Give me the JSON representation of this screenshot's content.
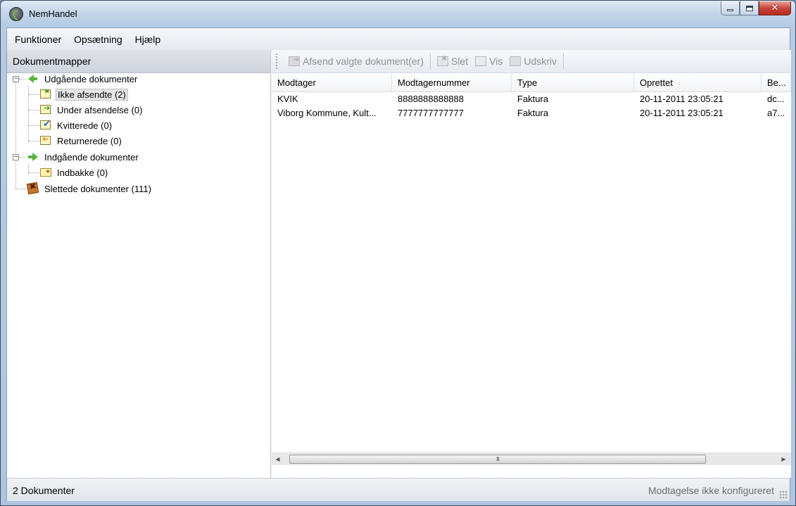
{
  "window": {
    "title": "NemHandel",
    "icon": "nemhandel-logo-icon",
    "caption_buttons": [
      "minimize",
      "maximize",
      "close"
    ]
  },
  "menubar": {
    "items": [
      "Funktioner",
      "Opsætning",
      "Hjælp"
    ]
  },
  "left_pane": {
    "header": "Dokumentmapper",
    "tree": {
      "outgoing": {
        "label": "Udgående dokumenter",
        "icon": "green-left-arrow-icon"
      },
      "not_sent": {
        "label": "Ikke afsendte (2)",
        "icon": "document-flag-icon",
        "selected": true
      },
      "sending": {
        "label": "Under afsendelse (0)",
        "icon": "document-send-icon"
      },
      "receipted": {
        "label": "Kvitterede (0)",
        "icon": "document-check-icon"
      },
      "returned": {
        "label": "Returnerede (0)",
        "icon": "document-return-icon"
      },
      "incoming": {
        "label": "Indgående dokumenter",
        "icon": "green-right-arrow-icon"
      },
      "inbox": {
        "label": "Indbakke (0)",
        "icon": "inbox-icon"
      },
      "deleted": {
        "label": "Slettede dokumenter (111)",
        "icon": "trash-icon"
      }
    }
  },
  "toolbar": {
    "send_label": "Afsend valgte dokument(er)",
    "delete_label": "Slet",
    "view_label": "Vis",
    "print_label": "Udskriv"
  },
  "grid": {
    "columns": [
      "Modtager",
      "Modtagernummer",
      "Type",
      "Oprettet",
      "Be..."
    ],
    "rows": [
      [
        "KVIK",
        "8888888888888",
        "Faktura",
        "20-11-2011 23:05:21",
        "dc..."
      ],
      [
        "Viborg Kommune, Kult...",
        "7777777777777",
        "Faktura",
        "20-11-2011 23:05:21",
        "a7..."
      ]
    ],
    "scroll_thumb_label": "III"
  },
  "statusbar": {
    "left": "2 Dokumenter",
    "right": "Modtagelse ikke konfigureret"
  }
}
